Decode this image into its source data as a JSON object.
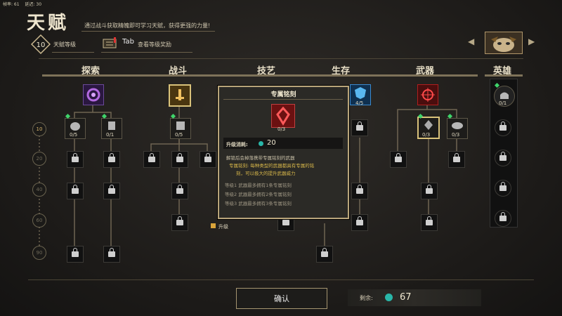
{
  "debug": {
    "fps": "帧率: 61",
    "ping": "延迟: 30"
  },
  "header": {
    "title": "天赋",
    "subtitle": "通过战斗获取精魄即可学习天赋，获得更强的力量!",
    "level_value": "10",
    "level_label": "天赋等级",
    "tab_key": "Tab",
    "tab_text": "查看等级奖励"
  },
  "columns": [
    "探索",
    "战斗",
    "技艺",
    "生存",
    "武器",
    "英雄"
  ],
  "level_rows": [
    "10",
    "20",
    "40",
    "60",
    "90"
  ],
  "nodes": {
    "explore_top": "0/5",
    "explore_a": "0/5",
    "explore_b": "0/1",
    "combat_top": "0/5",
    "combat_a": "0/5",
    "survival_top": "4/5",
    "weapon_a": "0/3",
    "weapon_b": "0/3",
    "hero_top": "0/1"
  },
  "tooltip": {
    "title": "专属铭刻",
    "count": "0/3",
    "cost_label": "升级消耗:",
    "cost_value": "20",
    "desc1": "解锁后会掉落携带专属铭刻的武器",
    "desc2": "专属铭刻: 每种类型的武器都具有专属的铭",
    "desc3": "刻，可以极大的提升武器威力",
    "tier1": "等级1    武器最多拥有1条专属铭刻",
    "tier2": "等级2    武器最多拥有2条专属铭刻",
    "tier3": "等级3    武器最多拥有3条专属铭刻"
  },
  "upgrade_label": "升级",
  "confirm_label": "确认",
  "remaining": {
    "label": "剩余:",
    "value": "67"
  },
  "colors": {
    "accent": "#b9a57a",
    "gem": "#29b6a8",
    "unlock": "#3fd46a",
    "weapon_red": "#b01e1e"
  }
}
